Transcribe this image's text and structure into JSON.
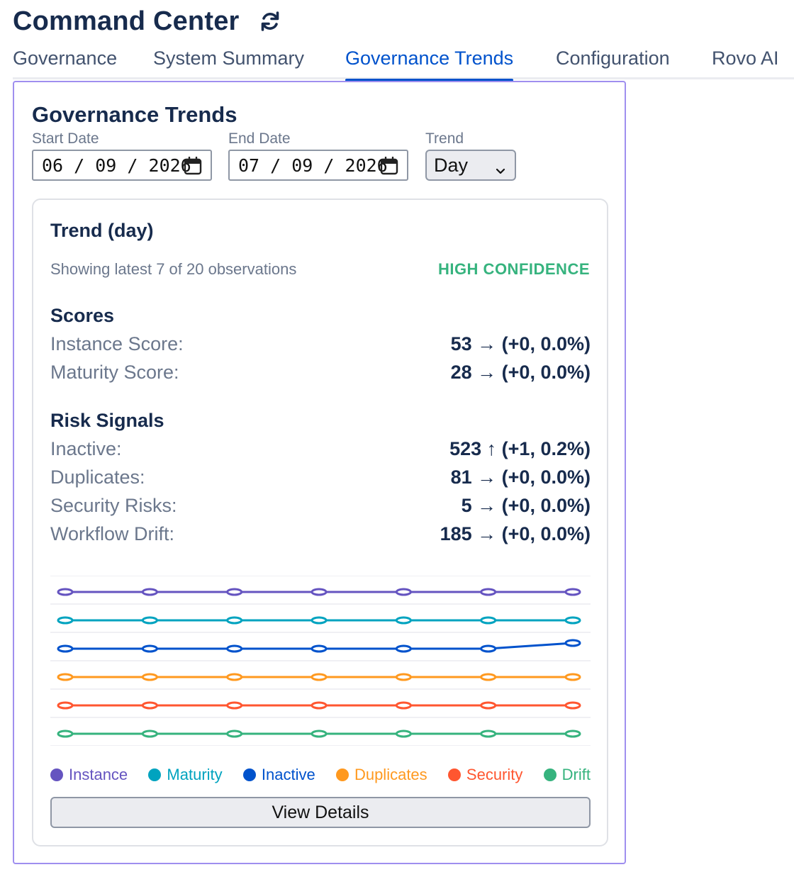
{
  "app": {
    "title": "Command Center",
    "refresh_icon": "refresh-icon"
  },
  "tabs": [
    {
      "label": "Governance"
    },
    {
      "label": "System Summary"
    },
    {
      "label": "Governance Trends",
      "active": true
    },
    {
      "label": "Configuration"
    },
    {
      "label": "Rovo AI"
    }
  ],
  "panel": {
    "title": "Governance Trends",
    "start_date": {
      "label": "Start Date",
      "value": "06 / 09 / 2026"
    },
    "end_date": {
      "label": "End Date",
      "value": "07 / 09 / 2026"
    },
    "trend": {
      "label": "Trend",
      "value": "Day",
      "icon": "chevron-down-icon"
    }
  },
  "card": {
    "title": "Trend (day)",
    "observations": "Showing latest 7 of 20 observations",
    "confidence": "HIGH CONFIDENCE",
    "scores": {
      "title": "Scores",
      "rows": [
        {
          "label": "Instance Score:",
          "value": "53 → (+0, 0.0%)"
        },
        {
          "label": "Maturity Score:",
          "value": "28 → (+0, 0.0%)"
        }
      ]
    },
    "risks": {
      "title": "Risk Signals",
      "rows": [
        {
          "label": "Inactive:",
          "value": "523 ↑ (+1, 0.2%)"
        },
        {
          "label": "Duplicates:",
          "value": "81 → (+0, 0.0%)"
        },
        {
          "label": "Security Risks:",
          "value": "5 → (+0, 0.0%)"
        },
        {
          "label": "Workflow Drift:",
          "value": "185 → (+0, 0.0%)"
        }
      ]
    },
    "view_details": "View Details"
  },
  "colors": {
    "instance": "#6554c0",
    "maturity": "#00a3bf",
    "inactive": "#0052cc",
    "duplicates": "#ff991f",
    "security": "#ff5630",
    "drift": "#36b37e"
  },
  "chart_data": {
    "type": "line",
    "x": [
      1,
      2,
      3,
      4,
      5,
      6,
      7
    ],
    "series": [
      {
        "name": "Instance",
        "values": [
          53,
          53,
          53,
          53,
          53,
          53,
          53
        ]
      },
      {
        "name": "Maturity",
        "values": [
          28,
          28,
          28,
          28,
          28,
          28,
          28
        ]
      },
      {
        "name": "Inactive",
        "values": [
          522,
          522,
          522,
          522,
          522,
          522,
          523
        ]
      },
      {
        "name": "Duplicates",
        "values": [
          81,
          81,
          81,
          81,
          81,
          81,
          81
        ]
      },
      {
        "name": "Security",
        "values": [
          5,
          5,
          5,
          5,
          5,
          5,
          5
        ]
      },
      {
        "name": "Drift",
        "values": [
          185,
          185,
          185,
          185,
          185,
          185,
          185
        ]
      }
    ]
  }
}
